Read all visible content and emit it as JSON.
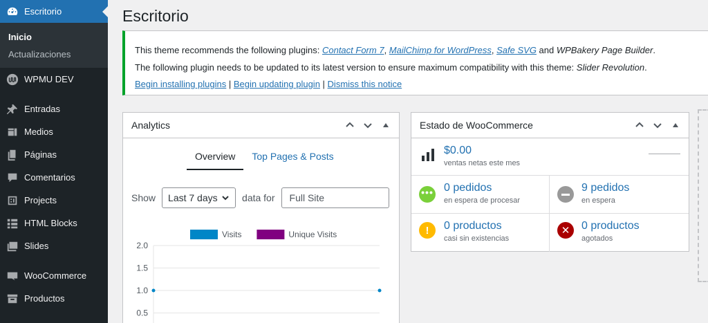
{
  "sidebar": {
    "dashboard": "Escritorio",
    "submenu": [
      "Inicio",
      "Actualizaciones"
    ],
    "items": [
      {
        "label": "WPMU DEV",
        "icon": "wpmudev-icon"
      },
      {
        "label": "Entradas",
        "icon": "pushpin-icon"
      },
      {
        "label": "Medios",
        "icon": "media-icon"
      },
      {
        "label": "Páginas",
        "icon": "pages-icon"
      },
      {
        "label": "Comentarios",
        "icon": "comment-icon"
      },
      {
        "label": "Projects",
        "icon": "portfolio-icon"
      },
      {
        "label": "HTML Blocks",
        "icon": "blocks-icon"
      },
      {
        "label": "Slides",
        "icon": "slides-icon"
      },
      {
        "label": "WooCommerce",
        "icon": "woocommerce-icon"
      },
      {
        "label": "Productos",
        "icon": "archive-icon"
      }
    ]
  },
  "page": {
    "title": "Escritorio"
  },
  "notice": {
    "l1_prefix": "This theme recommends the following plugins: ",
    "plugins": [
      "Contact Form 7",
      "MailChimp for WordPress",
      "Safe SVG"
    ],
    "sep": ", ",
    "and": " and ",
    "last_plugin": "WPBakery Page Builder",
    "period": ".",
    "l2_prefix": "The following plugin needs to be updated to its latest version to ensure maximum compatibility with this theme: ",
    "update_plugin": "Slider Revolution",
    "actions": [
      "Begin installing plugins",
      "Begin updating plugin",
      "Dismiss this notice"
    ],
    "pipe": " | "
  },
  "analytics": {
    "title": "Analytics",
    "tabs": [
      "Overview",
      "Top Pages & Posts"
    ],
    "show_label": "Show",
    "range": "Last 7 days",
    "data_for_label": "data for",
    "site": "Full Site"
  },
  "woo": {
    "title": "Estado de WooCommerce",
    "sales_value": "$0.00",
    "sales_label": "ventas netas este mes",
    "processing_value": "0 pedidos",
    "processing_label": "en espera de procesar",
    "onhold_value": "9 pedidos",
    "onhold_label": "en espera",
    "low_value": "0 productos",
    "low_label": "casi sin existencias",
    "out_value": "0 productos",
    "out_label": "agotados"
  },
  "colors": {
    "accent": "#2271b1",
    "sidebar": "#1d2327",
    "notice_border": "#00a32a",
    "visits": "#0086c7",
    "unique_visits": "#800080",
    "green": "#7ad03a",
    "gray": "#999999",
    "yellow": "#ffba00",
    "red": "#a00000"
  },
  "chart_data": {
    "type": "line",
    "series": [
      {
        "name": "Visits",
        "color": "#0086c7",
        "points": [
          [
            0,
            1.0
          ],
          [
            1,
            1.0
          ]
        ]
      },
      {
        "name": "Unique Visits",
        "color": "#800080",
        "points": []
      }
    ],
    "yticks": [
      "2.0",
      "1.5",
      "1.0",
      "0.5"
    ],
    "ylim": [
      0,
      2.0
    ],
    "legend_placement": "top"
  }
}
